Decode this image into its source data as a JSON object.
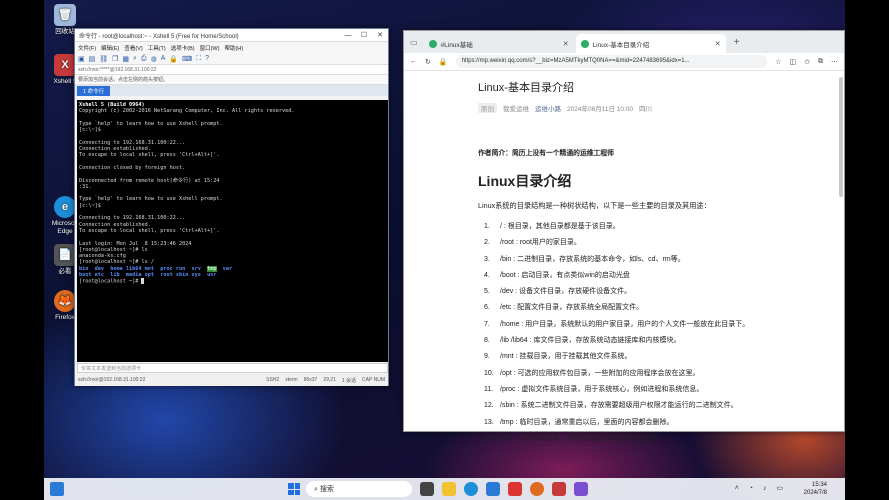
{
  "desktop": {
    "icons": [
      {
        "label": "回收站",
        "color": "#9fb7d8",
        "glyph": "🗑"
      },
      {
        "label": "Xshell 5",
        "color": "#c73a3a",
        "glyph": "X"
      },
      {
        "label": "Microsoft Edge",
        "color": "#1e8fd6",
        "glyph": "e"
      },
      {
        "label": "必看",
        "color": "#555",
        "glyph": "📄"
      },
      {
        "label": "Firefox",
        "color": "#e06a1f",
        "glyph": "🦊"
      }
    ]
  },
  "xshell": {
    "title": "命令行 - root@localhost:~ - Xshell 5 (Free for Home/School)",
    "menu": [
      "文件(F)",
      "编辑(E)",
      "查看(V)",
      "工具(T)",
      "选项卡(B)",
      "窗口(W)",
      "帮助(H)"
    ],
    "address": "ssh://root:*****@192.168.31.100:22",
    "tip": "要添加当前会话，点击左侧的箭头按钮。",
    "tab": "1 命令行",
    "terminal": [
      "Xshell 5 (Build 0964)",
      "Copyright (c) 2002-2016 NetSarang Computer, Inc. All rights reserved.",
      "",
      "Type `help' to learn how to use Xshell prompt.",
      "[c:\\~]$",
      "",
      "Connecting to 192.168.31.100:22...",
      "Connection established.",
      "To escape to local shell, press 'Ctrl+Alt+]'.",
      "",
      "Connection closed by foreign host.",
      "",
      "Disconnected from remote host(命令行) at 15:24",
      ":31.",
      "",
      "Type `help' to learn how to use Xshell prompt.",
      "[c:\\~]$",
      "",
      "Connecting to 192.168.31.100:22...",
      "Connection established.",
      "To escape to local shell, press 'Ctrl+Alt+]'.",
      "",
      "Last login: Mon Jul  8 15:23:46 2024",
      "[root@localhost ~]# ls",
      "anaconda-ks.cfg",
      "[root@localhost ~]# ls /"
    ],
    "ls_row1": [
      "bin",
      "dev",
      "home",
      "lib64",
      "mnt",
      "proc",
      "run",
      "srv",
      "tmp",
      "var"
    ],
    "ls_row2": [
      "boot",
      "etc",
      "lib",
      "media",
      "opt",
      "root",
      "sbin",
      "sys",
      "usr"
    ],
    "last_prompt": "[root@localhost ~]#",
    "send_placeholder": "仅将文本发送到当前选项卡",
    "status": {
      "conn": "ssh://root@192.168.31.100:22",
      "proto": "SSH2",
      "term": "xterm",
      "size": "86x37",
      "pos": "29,21",
      "sessions": "1 会话",
      "caps": "CAP NUM"
    }
  },
  "edge": {
    "tabs": [
      {
        "label": "#Linux基础",
        "active": false
      },
      {
        "label": "Linux-基本目录介绍",
        "active": true
      }
    ],
    "url": "https://mp.weixin.qq.com/s?__biz=MzA5MTkyMTQ0NA==&mid=2247483695&idx=1...",
    "article": {
      "title": "Linux-基本目录介绍",
      "tag": "原创",
      "author": "我爱运维",
      "account": "运维小路",
      "date": "2024年06月11日 10:00",
      "location": "四川",
      "intro": "作者简介：简历上没有一个精通的运维工程师",
      "heading": "Linux目录介绍",
      "lead": "Linux系统的目录结构是一种树状结构，以下是一些主要的目录及其用途：",
      "items": [
        "/ : 根目录，其他目录都是基于该目录。",
        "/root : root用户的家目录。",
        "/bin : 二进制目录，存放系统的基本命令，如ls、cd、rm等。",
        "/boot : 启动目录，有点类似win的启动光盘",
        "/dev : 设备文件目录，存放硬件设备文件。",
        "/etc : 配置文件目录，存放系统全局配置文件。",
        "/home : 用户目录，系统默认的用户家目录，用户的个人文件一般放在此目录下。",
        "/lib /lib64 : 库文件目录，存放系统动态链接库和内核模块。",
        "/mnt : 挂载目录，用于挂载其他文件系统。",
        "/opt : 可选的应用软件包目录，一些附加的应用程序会放在这里。",
        "/proc : 虚拟文件系统目录，用于系统核心，例如进程和系统信息。",
        "/sbin : 系统二进制文件目录，存放需要超级用户权限才能运行的二进制文件。",
        "/tmp : 临时目录，通常重启以后，里面的内容都会删除。",
        "/usr : 用户资源目录，通常重启是应用程序所在目录。"
      ]
    }
  },
  "taskbar": {
    "search_label": "搜索",
    "time": "15:34",
    "date": "2024/7/8"
  }
}
